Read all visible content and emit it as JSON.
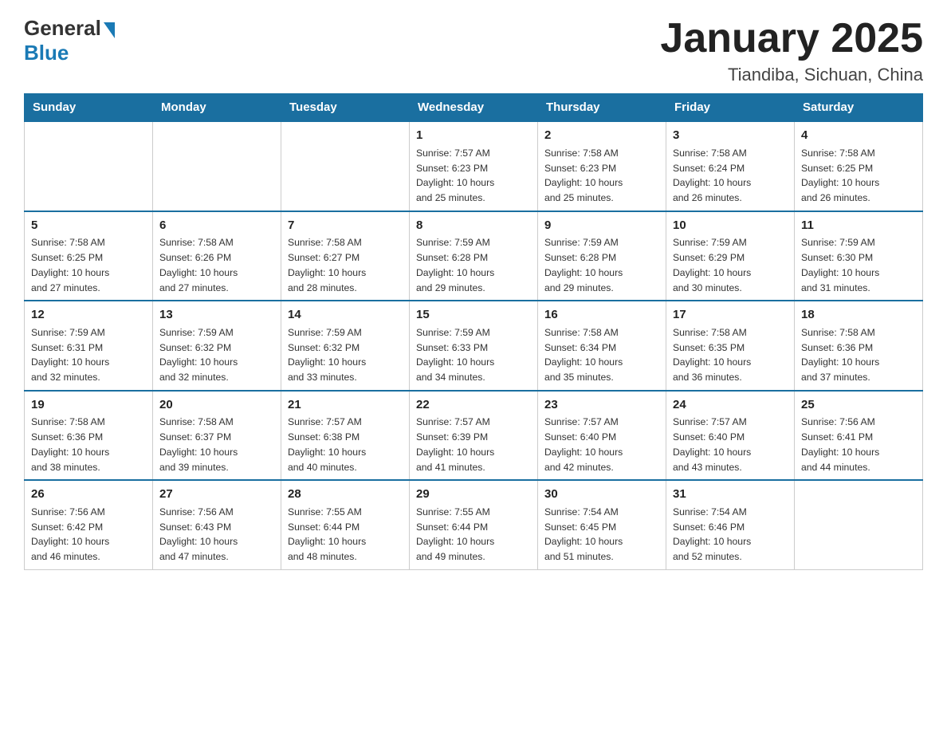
{
  "logo": {
    "general": "General",
    "blue": "Blue"
  },
  "title": "January 2025",
  "subtitle": "Tiandiba, Sichuan, China",
  "days_of_week": [
    "Sunday",
    "Monday",
    "Tuesday",
    "Wednesday",
    "Thursday",
    "Friday",
    "Saturday"
  ],
  "weeks": [
    [
      {
        "day": "",
        "info": ""
      },
      {
        "day": "",
        "info": ""
      },
      {
        "day": "",
        "info": ""
      },
      {
        "day": "1",
        "info": "Sunrise: 7:57 AM\nSunset: 6:23 PM\nDaylight: 10 hours\nand 25 minutes."
      },
      {
        "day": "2",
        "info": "Sunrise: 7:58 AM\nSunset: 6:23 PM\nDaylight: 10 hours\nand 25 minutes."
      },
      {
        "day": "3",
        "info": "Sunrise: 7:58 AM\nSunset: 6:24 PM\nDaylight: 10 hours\nand 26 minutes."
      },
      {
        "day": "4",
        "info": "Sunrise: 7:58 AM\nSunset: 6:25 PM\nDaylight: 10 hours\nand 26 minutes."
      }
    ],
    [
      {
        "day": "5",
        "info": "Sunrise: 7:58 AM\nSunset: 6:25 PM\nDaylight: 10 hours\nand 27 minutes."
      },
      {
        "day": "6",
        "info": "Sunrise: 7:58 AM\nSunset: 6:26 PM\nDaylight: 10 hours\nand 27 minutes."
      },
      {
        "day": "7",
        "info": "Sunrise: 7:58 AM\nSunset: 6:27 PM\nDaylight: 10 hours\nand 28 minutes."
      },
      {
        "day": "8",
        "info": "Sunrise: 7:59 AM\nSunset: 6:28 PM\nDaylight: 10 hours\nand 29 minutes."
      },
      {
        "day": "9",
        "info": "Sunrise: 7:59 AM\nSunset: 6:28 PM\nDaylight: 10 hours\nand 29 minutes."
      },
      {
        "day": "10",
        "info": "Sunrise: 7:59 AM\nSunset: 6:29 PM\nDaylight: 10 hours\nand 30 minutes."
      },
      {
        "day": "11",
        "info": "Sunrise: 7:59 AM\nSunset: 6:30 PM\nDaylight: 10 hours\nand 31 minutes."
      }
    ],
    [
      {
        "day": "12",
        "info": "Sunrise: 7:59 AM\nSunset: 6:31 PM\nDaylight: 10 hours\nand 32 minutes."
      },
      {
        "day": "13",
        "info": "Sunrise: 7:59 AM\nSunset: 6:32 PM\nDaylight: 10 hours\nand 32 minutes."
      },
      {
        "day": "14",
        "info": "Sunrise: 7:59 AM\nSunset: 6:32 PM\nDaylight: 10 hours\nand 33 minutes."
      },
      {
        "day": "15",
        "info": "Sunrise: 7:59 AM\nSunset: 6:33 PM\nDaylight: 10 hours\nand 34 minutes."
      },
      {
        "day": "16",
        "info": "Sunrise: 7:58 AM\nSunset: 6:34 PM\nDaylight: 10 hours\nand 35 minutes."
      },
      {
        "day": "17",
        "info": "Sunrise: 7:58 AM\nSunset: 6:35 PM\nDaylight: 10 hours\nand 36 minutes."
      },
      {
        "day": "18",
        "info": "Sunrise: 7:58 AM\nSunset: 6:36 PM\nDaylight: 10 hours\nand 37 minutes."
      }
    ],
    [
      {
        "day": "19",
        "info": "Sunrise: 7:58 AM\nSunset: 6:36 PM\nDaylight: 10 hours\nand 38 minutes."
      },
      {
        "day": "20",
        "info": "Sunrise: 7:58 AM\nSunset: 6:37 PM\nDaylight: 10 hours\nand 39 minutes."
      },
      {
        "day": "21",
        "info": "Sunrise: 7:57 AM\nSunset: 6:38 PM\nDaylight: 10 hours\nand 40 minutes."
      },
      {
        "day": "22",
        "info": "Sunrise: 7:57 AM\nSunset: 6:39 PM\nDaylight: 10 hours\nand 41 minutes."
      },
      {
        "day": "23",
        "info": "Sunrise: 7:57 AM\nSunset: 6:40 PM\nDaylight: 10 hours\nand 42 minutes."
      },
      {
        "day": "24",
        "info": "Sunrise: 7:57 AM\nSunset: 6:40 PM\nDaylight: 10 hours\nand 43 minutes."
      },
      {
        "day": "25",
        "info": "Sunrise: 7:56 AM\nSunset: 6:41 PM\nDaylight: 10 hours\nand 44 minutes."
      }
    ],
    [
      {
        "day": "26",
        "info": "Sunrise: 7:56 AM\nSunset: 6:42 PM\nDaylight: 10 hours\nand 46 minutes."
      },
      {
        "day": "27",
        "info": "Sunrise: 7:56 AM\nSunset: 6:43 PM\nDaylight: 10 hours\nand 47 minutes."
      },
      {
        "day": "28",
        "info": "Sunrise: 7:55 AM\nSunset: 6:44 PM\nDaylight: 10 hours\nand 48 minutes."
      },
      {
        "day": "29",
        "info": "Sunrise: 7:55 AM\nSunset: 6:44 PM\nDaylight: 10 hours\nand 49 minutes."
      },
      {
        "day": "30",
        "info": "Sunrise: 7:54 AM\nSunset: 6:45 PM\nDaylight: 10 hours\nand 51 minutes."
      },
      {
        "day": "31",
        "info": "Sunrise: 7:54 AM\nSunset: 6:46 PM\nDaylight: 10 hours\nand 52 minutes."
      },
      {
        "day": "",
        "info": ""
      }
    ]
  ]
}
